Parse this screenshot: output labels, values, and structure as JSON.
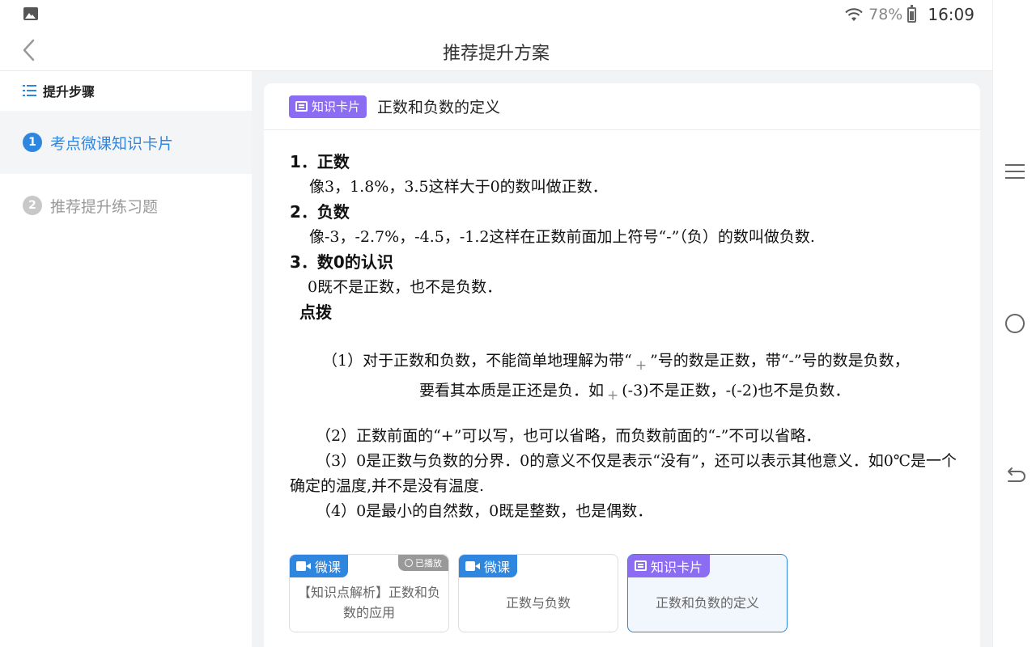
{
  "status_bar": {
    "battery": "78%",
    "time": "16:09"
  },
  "header": {
    "title": "推荐提升方案"
  },
  "sidebar": {
    "heading": "提升步骤",
    "steps": [
      {
        "num": "1",
        "label": "考点微课知识卡片"
      },
      {
        "num": "2",
        "label": "推荐提升练习题"
      }
    ]
  },
  "card": {
    "tag": "知识卡片",
    "title": "正数和负数的定义",
    "s1_title": "1．正数",
    "s1_body": "像3，1.8%，3.5这样大于0的数叫做正数．",
    "s2_title": "2．负数",
    "s2_body": "像-3，-2.7%，-4.5，-1.2这样在正数前面加上符号“-”（负）的数叫做负数.",
    "s3_title": "3．数0的认识",
    "s3_body": "0既不是正数，也不是负数．",
    "hint_title": "点拨",
    "hint1_a": "（1）对于正数和负数，不能简单地理解为带“",
    "hint1_plus": "+",
    "hint1_b": "”号的数是正数，带“-”号的数是负数，",
    "hint1_c": "要看其本质是正还是负．如",
    "hint1_d": "(-3)不是正数，-(-2)也不是负数．",
    "hint2": "（2）正数前面的“+”可以写，也可以省略，而负数前面的“-”不可以省略．",
    "hint3": "（3）0是正数与负数的分界．0的意义不仅是表示“没有”，还可以表示其他意义．如0℃是一个确定的温度,并不是没有温度.",
    "hint4": "（4）0是最小的自然数，0既是整数，也是偶数．"
  },
  "resources": [
    {
      "tag": "微课",
      "badge": "已播放",
      "text": "【知识点解析】正数和负数的应用"
    },
    {
      "tag": "微课",
      "text": "正数与负数"
    },
    {
      "tag": "知识卡片",
      "text": "正数和负数的定义"
    }
  ],
  "colors": {
    "accent": "#2e86de",
    "card_tag": "#8b6cf3",
    "played_badge": "#999999"
  }
}
